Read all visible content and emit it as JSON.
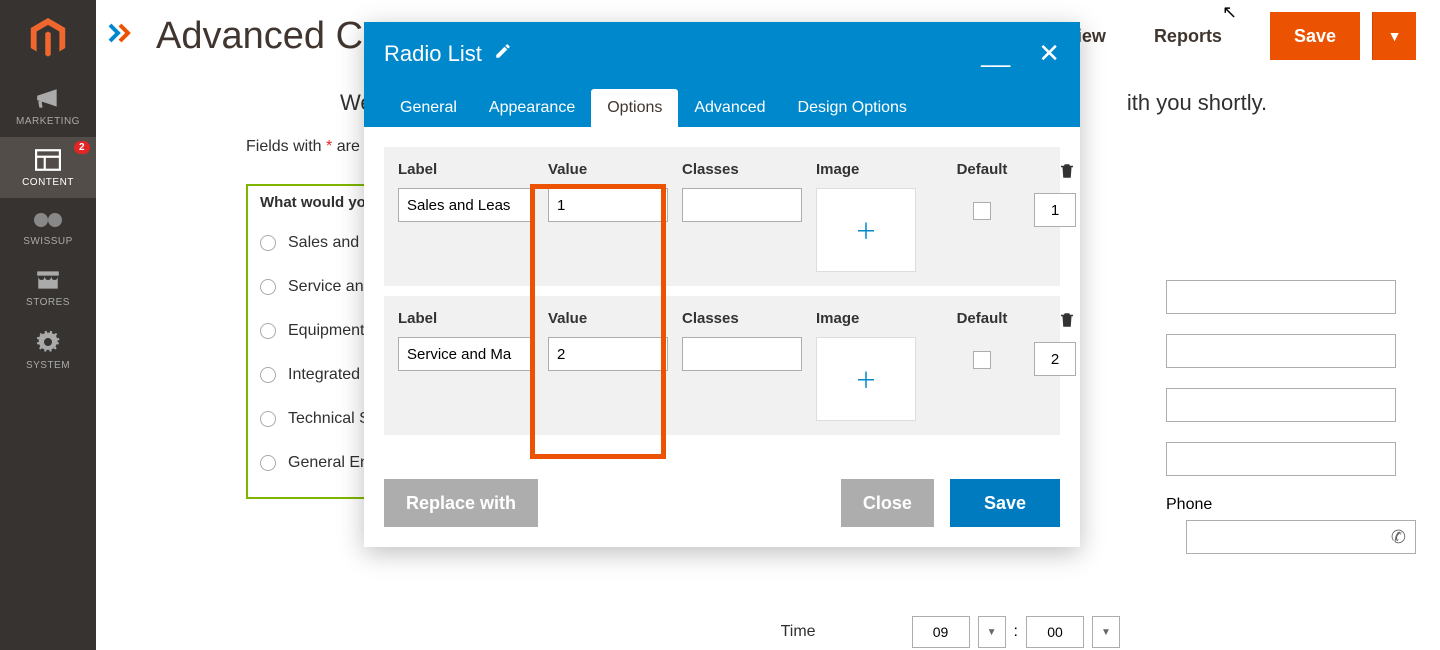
{
  "sidebar": {
    "items": [
      {
        "label": "MARKETING",
        "icon": "megaphone-icon"
      },
      {
        "label": "CONTENT",
        "icon": "layout-icon",
        "active": true,
        "badge": "2"
      },
      {
        "label": "SWISSUP",
        "icon": "swissup-icon"
      },
      {
        "label": "STORES",
        "icon": "store-icon"
      },
      {
        "label": "SYSTEM",
        "icon": "gear-icon"
      }
    ]
  },
  "header": {
    "title": "Advanced Cont",
    "view_label": "View",
    "reports_label": "Reports",
    "save_label": "Save"
  },
  "page": {
    "intro_left": "We w",
    "intro_right": "ith you shortly.",
    "required_note_prefix": "Fields with ",
    "required_note_suffix": " are re",
    "radio_title": "What would you li",
    "radio_options": [
      "Sales and Leas",
      "Service and Ma",
      "Equipment Ren",
      "Integrated Syst",
      "Technical Supp",
      "General Enquir"
    ],
    "phone_label": "Phone",
    "time_label": "Time",
    "time_hour": "09",
    "time_min": "00"
  },
  "modal": {
    "title": "Radio List",
    "tabs": [
      "General",
      "Appearance",
      "Options",
      "Advanced",
      "Design Options"
    ],
    "active_tab": 2,
    "columns": {
      "label": "Label",
      "value": "Value",
      "classes": "Classes",
      "image": "Image",
      "default": "Default"
    },
    "rows": [
      {
        "label": "Sales and Leas",
        "value": "1",
        "classes": "",
        "default_checked": false,
        "order": "1"
      },
      {
        "label": "Service and Ma",
        "value": "2",
        "classes": "",
        "default_checked": false,
        "order": "2"
      }
    ],
    "footer": {
      "replace": "Replace with",
      "close": "Close",
      "save": "Save"
    }
  }
}
